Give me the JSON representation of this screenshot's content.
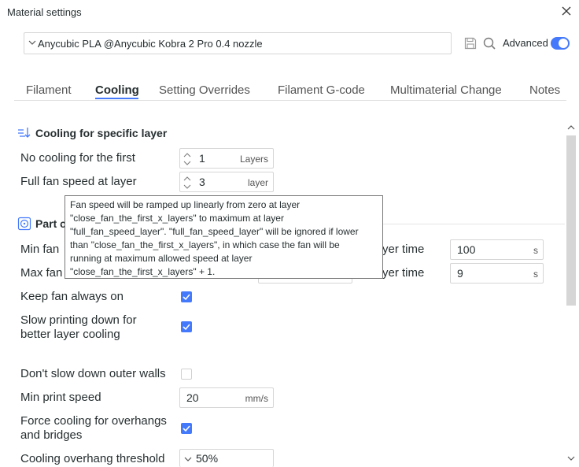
{
  "window": {
    "title": "Material settings"
  },
  "preset": {
    "name": "Anycubic PLA @Anycubic Kobra 2 Pro 0.4 nozzle"
  },
  "toolbar": {
    "advanced_label": "Advanced",
    "advanced_on": true
  },
  "tabs": [
    {
      "label": "Filament",
      "active": false
    },
    {
      "label": "Cooling",
      "active": true
    },
    {
      "label": "Setting Overrides",
      "active": false
    },
    {
      "label": "Filament G-code",
      "active": false
    },
    {
      "label": "Multimaterial Change",
      "active": false
    },
    {
      "label": "Notes",
      "active": false
    }
  ],
  "cooling_layer": {
    "title": "Cooling for specific layer",
    "no_cooling": {
      "label": "No cooling for the first",
      "value": "1",
      "unit": "Layers"
    },
    "full_fan": {
      "label": "Full fan speed at layer",
      "value": "3",
      "unit": "layer"
    }
  },
  "part_cooling": {
    "title_visible": "Part c",
    "min_fan_label": "Min fan",
    "max_fan_label": "Max fan",
    "min_layer_time_label": "yer time",
    "min_layer_time_value": "100",
    "min_layer_time_unit": "s",
    "max_layer_time_label": "yer time",
    "max_layer_time_value": "9",
    "max_layer_time_unit": "s",
    "keep_fan": {
      "label": "Keep fan always on",
      "checked": true
    },
    "slow_down": {
      "label_line1": "Slow printing down for",
      "label_line2": "better layer cooling",
      "checked": true
    },
    "outer_walls": {
      "label": "Don't slow down outer walls",
      "checked": false
    },
    "min_speed": {
      "label": "Min print speed",
      "value": "20",
      "unit": "mm/s"
    },
    "force_cooling": {
      "label_line1": "Force cooling for overhangs",
      "label_line2": "and bridges",
      "checked": true
    },
    "overhang_threshold": {
      "label": "Cooling overhang threshold",
      "value": "50%"
    }
  },
  "tooltip": {
    "lines": [
      "Fan speed will be ramped up linearly from zero at layer",
      "\"close_fan_the_first_x_layers\" to maximum at layer",
      "\"full_fan_speed_layer\". \"full_fan_speed_layer\" will be ignored if lower",
      "than \"close_fan_the_first_x_layers\", in which case the fan will be",
      "running at maximum allowed speed at layer",
      "\"close_fan_the_first_x_layers\" + 1."
    ]
  },
  "colors": {
    "accent": "#4479fb",
    "text": "#262e30",
    "border": "#d6d6d6"
  },
  "icons": [
    "close-icon",
    "chevron-down-icon",
    "save-icon",
    "search-icon",
    "cooling-layer-icon",
    "fan-icon",
    "checkmark-icon"
  ]
}
